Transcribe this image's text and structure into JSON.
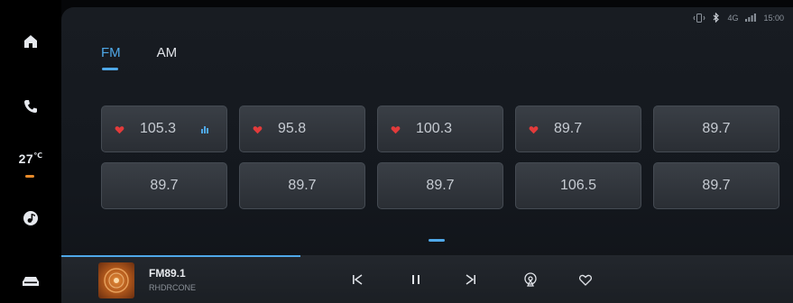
{
  "dock": {
    "temperature": "27",
    "temperature_unit": "℃",
    "items": [
      "home-icon",
      "phone-icon",
      "climate-temperature",
      "music-icon",
      "car-icon"
    ]
  },
  "status_bar": {
    "icons": [
      "vibrate-icon",
      "bluetooth-icon",
      "signal-icon"
    ],
    "network": "4G",
    "time": "15:00"
  },
  "tabs": [
    {
      "label": "FM",
      "active": true
    },
    {
      "label": "AM",
      "active": false
    }
  ],
  "presets": [
    {
      "freq": "105.3",
      "favorite": true,
      "playing": true
    },
    {
      "freq": "95.8",
      "favorite": true,
      "playing": false
    },
    {
      "freq": "100.3",
      "favorite": true,
      "playing": false
    },
    {
      "freq": "89.7",
      "favorite": true,
      "playing": false
    },
    {
      "freq": "89.7",
      "favorite": false,
      "playing": false
    },
    {
      "freq": "89.7",
      "favorite": false,
      "playing": false
    },
    {
      "freq": "89.7",
      "favorite": false,
      "playing": false
    },
    {
      "freq": "89.7",
      "favorite": false,
      "playing": false
    },
    {
      "freq": "106.5",
      "favorite": false,
      "playing": false
    },
    {
      "freq": "89.7",
      "favorite": false,
      "playing": false
    }
  ],
  "player": {
    "title": "FM89.1",
    "subtitle": "RHDRCONE",
    "controls": [
      "previous-icon",
      "pause-icon",
      "next-icon",
      "radio-source-icon",
      "favorite-icon"
    ]
  },
  "colors": {
    "accent": "#4fa8e8",
    "favorite": "#e23b3b",
    "temp_indicator": "#e88a2a"
  }
}
